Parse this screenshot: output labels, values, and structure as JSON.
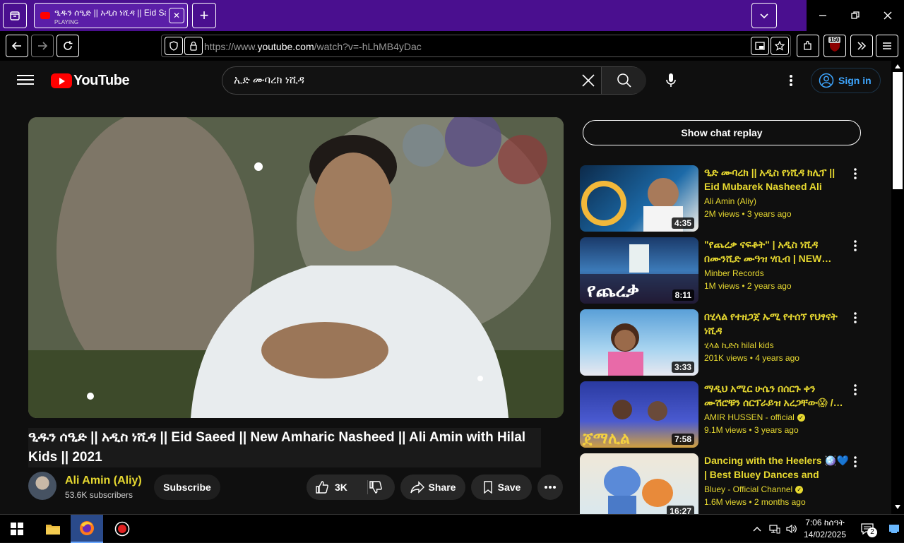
{
  "browser": {
    "tab_title": "ዒዱን ሰዒድ || አዲስ ነሺዳ || Eid Saeed",
    "tab_status": "PLAYING",
    "url_prefix": "https://www.",
    "url_domain": "youtube.com",
    "url_suffix": "/watch?v=-hLhMB4yDac",
    "extension_badge": "150"
  },
  "youtube": {
    "logo_text": "YouTube",
    "search_value": "ኢድ ሙባረክ ነሺዳ",
    "signin_label": "Sign in",
    "video": {
      "title": "ዒዱን ሰዒድ || አዲስ ነሺዳ || Eid Saeed || New Amharic Nasheed || Ali Amin with Hilal Kids || 2021",
      "channel": "Ali Amin (Aliy)",
      "subscribers": "53.6K subscribers",
      "subscribe_label": "Subscribe",
      "likes": "3K",
      "share_label": "Share",
      "save_label": "Save"
    },
    "chat_replay_label": "Show chat replay",
    "recommendations": [
      {
        "title": "ዒድ ሙባረክ || አዲስ የነሺዳ ክሊፕ || Eid Mubarek Nasheed Ali Ami…",
        "channel": "Ali Amin (Aliy)",
        "views": "2M views",
        "age": "3 years ago",
        "duration": "4:35",
        "verified": false
      },
      {
        "title": "\"የጨረቃ ናፍቆት\" | አዲስ ነሺዳ በሙንሺድ ሙዓዝ ሃቢብ | NEW…",
        "channel": "Minber Records",
        "views": "1M views",
        "age": "2 years ago",
        "duration": "8:11",
        "verified": false
      },
      {
        "title": "በሂላል የተዘጋጀ ኡሚ የተሰኘ የህፃናት ነሺዳ",
        "channel": "ሂላል ኪድስ hilal kids",
        "views": "201K views",
        "age": "4 years ago",
        "duration": "3:33",
        "verified": false
      },
      {
        "title": "ማዲህ አሚር ሁሴን በሰርጉ ቀን ሙሽሮቹን ሰርፕራይዝ አረጋቸው😱 /…",
        "channel": "AMIR HUSSEN - official",
        "views": "9.1M views",
        "age": "3 years ago",
        "duration": "7:58",
        "verified": true
      },
      {
        "title": "Dancing with the Heelers 🪩💙 | Best Bluey Dances and More!…",
        "channel": "Bluey - Official Channel",
        "views": "1.6M views",
        "age": "2 months ago",
        "duration": "16:27",
        "verified": true
      }
    ]
  },
  "taskbar": {
    "time": "7:06 ከሰዓት",
    "date": "14/02/2025",
    "notification_count": "2"
  }
}
